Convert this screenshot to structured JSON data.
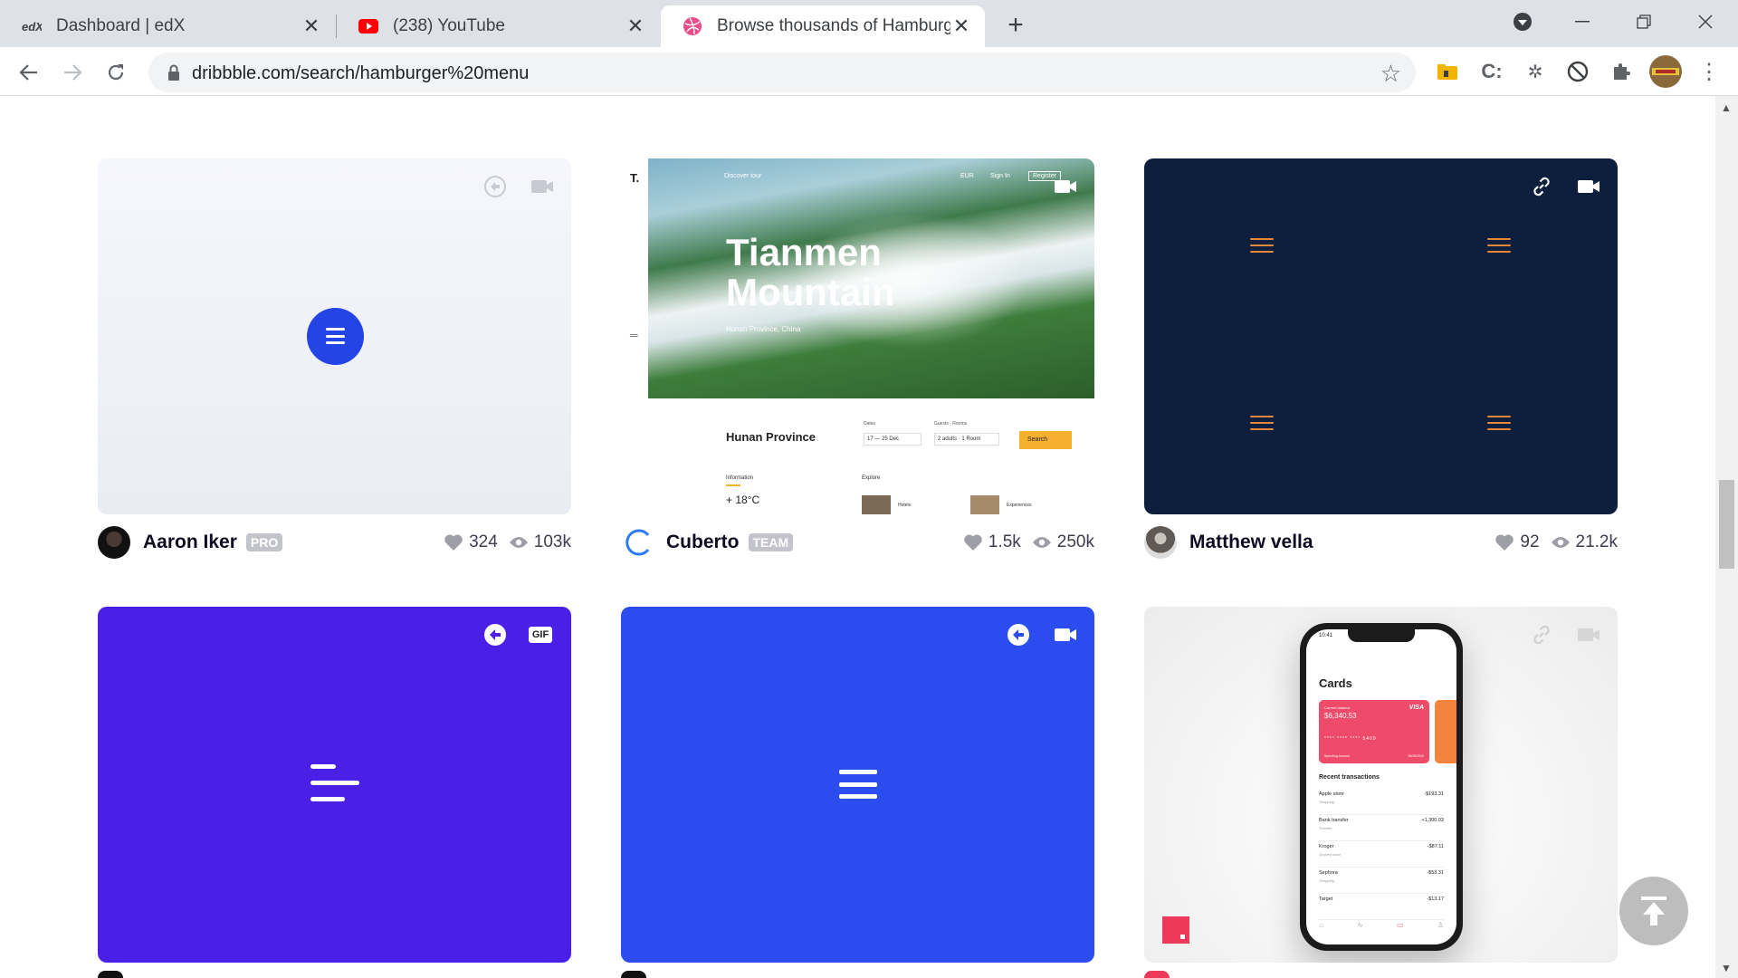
{
  "browser": {
    "tabs": [
      {
        "title": "Dashboard | edX",
        "favicon": "edx-logo-icon",
        "active": false
      },
      {
        "title": "(238) YouTube",
        "favicon": "youtube-logo-icon",
        "active": false
      },
      {
        "title": "Browse thousands of Hamburger",
        "favicon": "dribbble-logo-icon",
        "active": true
      }
    ],
    "url": "dribbble.com/search/hamburger%20menu"
  },
  "shots": [
    {
      "author": "Aaron Iker",
      "badge": "PRO",
      "likes": "324",
      "views": "103k",
      "bg": "#eef0f7",
      "overlay_icons": [
        "share-icon",
        "video-icon"
      ],
      "preview": "blue-circle-hamburger"
    },
    {
      "author": "Cuberto",
      "badge": "TEAM",
      "likes": "1.5k",
      "views": "250k",
      "bg": "#ffffff",
      "overlay_icons": [
        "video-icon"
      ],
      "preview": "tianmen-website",
      "preview_text": {
        "logo": "T.",
        "nav_discover": "Discover tour",
        "nav_eur": "EUR",
        "nav_signin": "Sign In",
        "nav_register": "Register",
        "hero_title": "Tianmen Mountain",
        "hero_sub": "Hunan Province, China",
        "province": "Hunan Province",
        "dates_label": "Dates",
        "dates_value": "17 — 25 Dec",
        "guests_label": "Guests · Rooms",
        "guests_value": "2 adults · 1 Room",
        "search": "Search",
        "info_label": "Information",
        "temp": "+ 18°C",
        "explore_label": "Explore",
        "hotels": "Hotels",
        "experiences": "Experiences"
      }
    },
    {
      "author": "Matthew vella",
      "badge": "",
      "likes": "92",
      "views": "21.2k",
      "bg": "#0d1f3c",
      "overlay_icons": [
        "link-icon",
        "video-icon"
      ],
      "preview": "four-orange-hamburgers"
    },
    {
      "author": "",
      "badge": "",
      "likes": "",
      "views": "",
      "bg": "#4b20e6",
      "overlay_icons": [
        "share-icon",
        "gif-badge"
      ],
      "preview": "white-left-aligned-hamburger",
      "gif_label": "GIF"
    },
    {
      "author": "",
      "badge": "",
      "likes": "",
      "views": "",
      "bg": "#2b4df0",
      "overlay_icons": [
        "share-icon",
        "video-icon"
      ],
      "preview": "white-hamburger"
    },
    {
      "author": "",
      "badge": "",
      "likes": "",
      "views": "",
      "bg": "#f1f1f1",
      "overlay_icons": [
        "link-icon",
        "video-icon"
      ],
      "preview": "phone-cards-app",
      "phone": {
        "time": "10:41",
        "title": "Cards",
        "card_label": "Current balance",
        "card_brand": "VISA",
        "card_amount": "$6,340.53",
        "card_number": "**** **** **** 5409",
        "card_sub": "Spending Account",
        "card_date": "08/29/2020",
        "section": "Recent transactions",
        "transactions": [
          {
            "name": "Apple store",
            "cat": "Shopping",
            "amount": "-$193.31"
          },
          {
            "name": "Bank transfer",
            "cat": "Transfer",
            "amount": "+1,300.03"
          },
          {
            "name": "Kroger",
            "cat": "Grocery store",
            "amount": "-$87.11"
          },
          {
            "name": "Sephora",
            "cat": "Shopping",
            "amount": "-$53.31"
          },
          {
            "name": "Target",
            "cat": "",
            "amount": "-$13.17"
          }
        ]
      }
    }
  ],
  "colors": {
    "dribbble_pink": "#ea4c89",
    "orange": "#e38a3a",
    "cuberto_search": "#f5b02e",
    "card_pink": "#ee4a6a"
  }
}
